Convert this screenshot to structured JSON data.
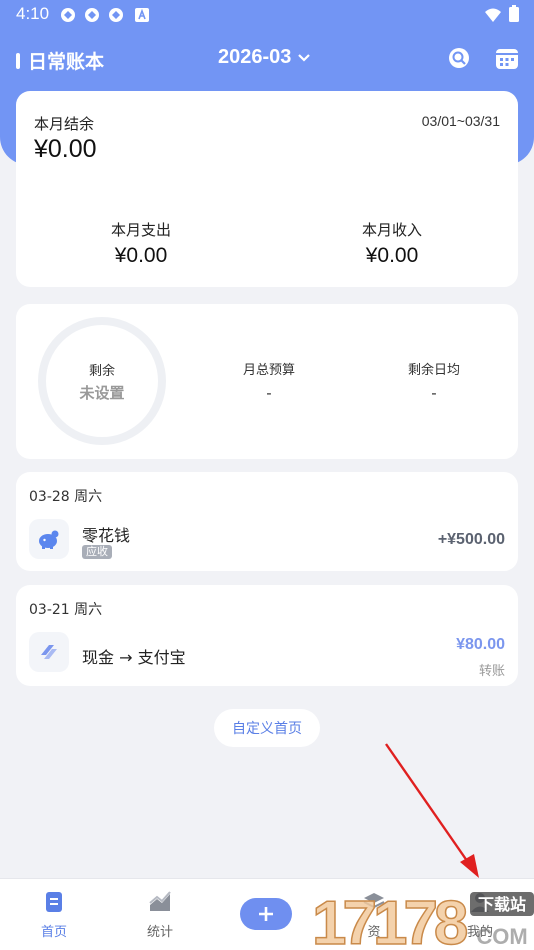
{
  "status_bar": {
    "time": "4:10"
  },
  "header": {
    "book_title": "日常账本",
    "month": "2026-03"
  },
  "summary": {
    "label": "本月结余",
    "date_range": "03/01~03/31",
    "balance": "¥0.00",
    "expense_label": "本月支出",
    "expense_value": "¥0.00",
    "income_label": "本月收入",
    "income_value": "¥0.00"
  },
  "budget": {
    "ring_label": "剩余",
    "ring_value": "未设置",
    "monthly_budget_label": "月总预算",
    "monthly_budget_value": "-",
    "daily_avg_label": "剩余日均",
    "daily_avg_value": "-"
  },
  "days": [
    {
      "date": "03-28 周六",
      "transactions": [
        {
          "name": "零花钱",
          "tag": "应收",
          "amount": "+¥500.00",
          "amount_color": "#5b6270",
          "icon": "piggy-bank-icon"
        }
      ]
    },
    {
      "date": "03-21 周六",
      "transactions": [
        {
          "name": "现金 → 支付宝",
          "amount": "¥80.00",
          "sub": "转账",
          "amount_color": "#7b96ee",
          "icon": "transfer-icon"
        }
      ]
    }
  ],
  "custom_home_label": "自定义首页",
  "tabs": [
    {
      "label": "首页",
      "active": true
    },
    {
      "label": "统计",
      "active": false
    },
    {
      "label": "资",
      "active": false
    },
    {
      "label": "我的",
      "active": false
    }
  ],
  "watermark": {
    "number": "17178",
    "site": "下载站",
    "domain": "COM"
  },
  "colors": {
    "accent": "#7295f4",
    "page_bg": "#f1f2f6",
    "annotation_arrow": "#e02020"
  }
}
